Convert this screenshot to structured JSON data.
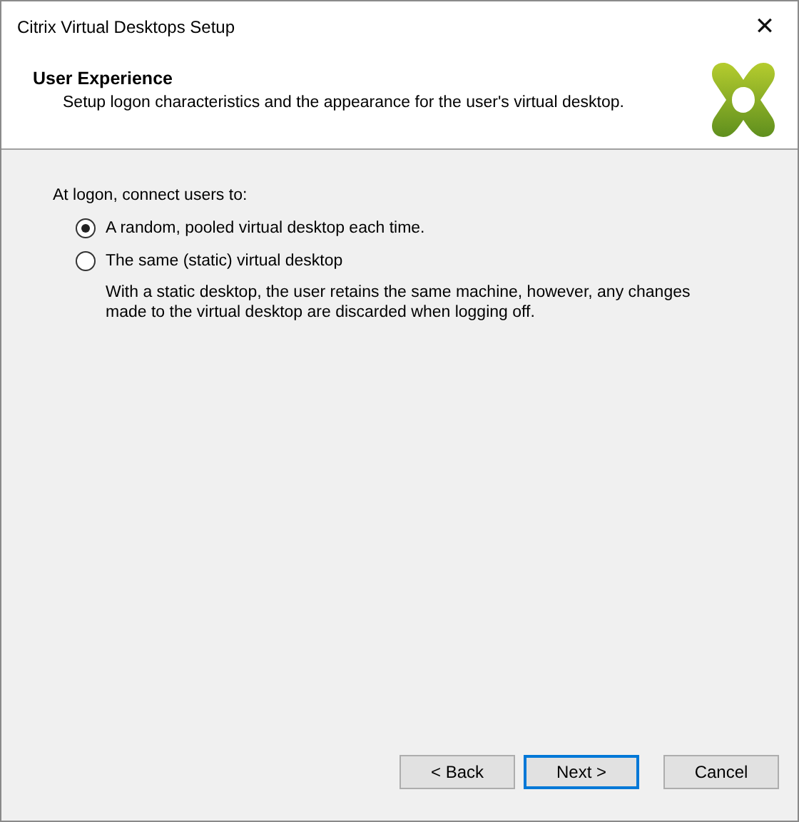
{
  "window": {
    "title": "Citrix Virtual Desktops Setup",
    "close": "✕"
  },
  "header": {
    "title": "User Experience",
    "subtitle": "Setup logon characteristics and the appearance for the user's virtual desktop."
  },
  "prompt": "At logon, connect users to:",
  "options": [
    {
      "label": "A random, pooled virtual desktop each time.",
      "selected": true
    },
    {
      "label": "The same (static) virtual desktop",
      "selected": false,
      "note": "With a static desktop, the user retains the same machine, however, any changes made to the virtual desktop are discarded when logging off."
    }
  ],
  "buttons": [
    {
      "label": "< Back",
      "default": false
    },
    {
      "label": "Next >",
      "default": true
    },
    {
      "label": "Cancel",
      "default": false
    }
  ]
}
